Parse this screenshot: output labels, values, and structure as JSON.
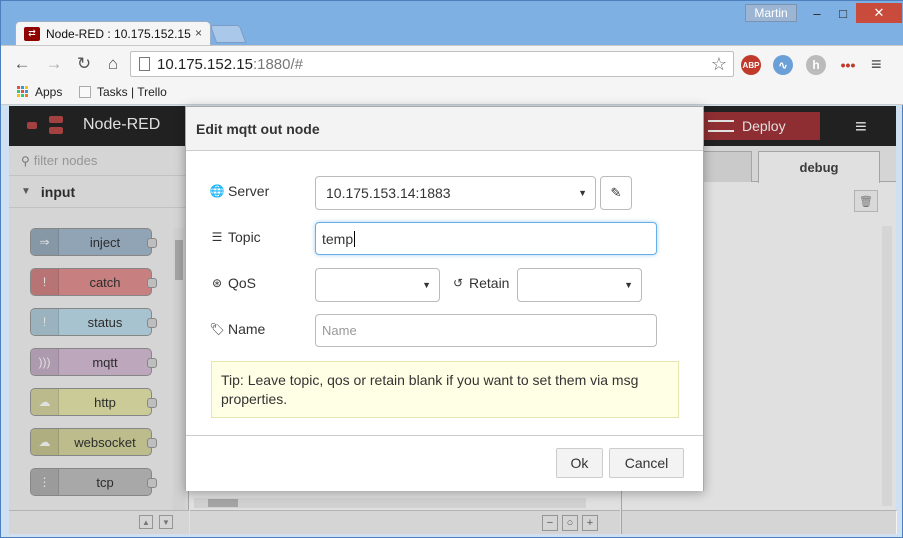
{
  "browser": {
    "tab_title": "Node-RED : 10.175.152.15",
    "tab_close": "×",
    "user": "Martin",
    "win_min": "–",
    "win_max": "□",
    "win_close": "✕",
    "url_host": "10.175.152.15",
    "url_rest": ":1880/#",
    "bookmarks": [
      {
        "label": "Apps"
      },
      {
        "label": "Tasks | Trello"
      }
    ],
    "extensions": {
      "abp": "ABP",
      "h": "h"
    }
  },
  "app": {
    "title": "Node-RED",
    "deploy_label": "Deploy",
    "palette": {
      "filter_placeholder": "filter nodes",
      "category": "input",
      "nodes": [
        {
          "label": "inject",
          "color": "#a6bbcf"
        },
        {
          "label": "catch",
          "color": "#e49191"
        },
        {
          "label": "status",
          "color": "#c0deed"
        },
        {
          "label": "mqtt",
          "color": "#d8bfd8"
        },
        {
          "label": "http",
          "color": "#e7e7ae"
        },
        {
          "label": "websocket",
          "color": "#d7d7a0"
        },
        {
          "label": "tcp",
          "color": "#c0c0c0"
        }
      ]
    },
    "sidebar": {
      "active_tab": "debug"
    }
  },
  "dialog": {
    "title": "Edit mqtt out node",
    "server_label": "Server",
    "server_value": "10.175.153.14:1883",
    "topic_label": "Topic",
    "topic_value": "temp",
    "qos_label": "QoS",
    "qos_value": "",
    "retain_label": "Retain",
    "retain_value": "",
    "name_label": "Name",
    "name_placeholder": "Name",
    "tip": "Tip: Leave topic, qos or retain blank if you want to set them via msg properties.",
    "ok_label": "Ok",
    "cancel_label": "Cancel"
  }
}
